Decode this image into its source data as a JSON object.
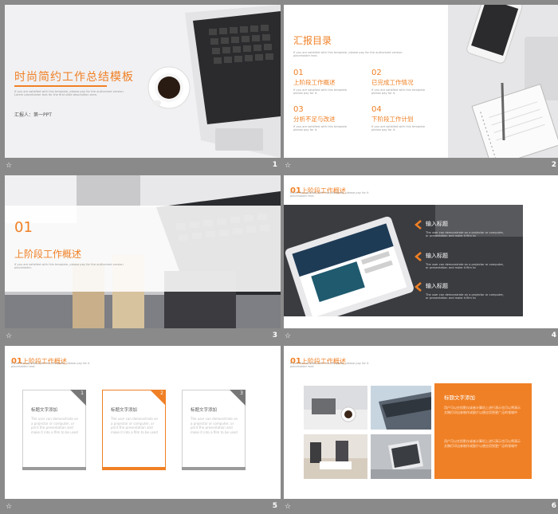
{
  "slides": [
    {
      "number": "1",
      "title": "时尚简约工作总结模板",
      "desc": "If you are satisfied with this template, please pay for the authorized version. Lorem placeholder text for the first slide description area.",
      "reporter": "汇报人：第一PPT"
    },
    {
      "number": "2",
      "title": "汇报目录",
      "desc": "If you are satisfied with this template, please pay for the authorized version placeholder text.",
      "items": [
        {
          "num": "01",
          "label": "上阶段工作概述",
          "desc": "If you are satisfied with this template please pay for it."
        },
        {
          "num": "02",
          "label": "已完成工作情况",
          "desc": "If you are satisfied with this template please pay for it."
        },
        {
          "num": "03",
          "label": "分析不足与改进",
          "desc": "If you are satisfied with this template please pay for it."
        },
        {
          "num": "04",
          "label": "下阶段工作计划",
          "desc": "If you are satisfied with this template please pay for it."
        }
      ]
    },
    {
      "number": "3",
      "num": "01",
      "title": "上阶段工作概述",
      "desc": "If you are satisfied with this template, please pay for the authorized version placeholder."
    },
    {
      "number": "4",
      "num": "01",
      "title": "上阶段工作概述",
      "desc": "If you are satisfied with this template, please pay for it placeholder text.",
      "items": [
        {
          "label": "输入标题",
          "desc": "The user can demonstrate on a projector or computer, or presentation and make it film to"
        },
        {
          "label": "输入标题",
          "desc": "The user can demonstrate on a projector or computer, or presentation and make it film to"
        },
        {
          "label": "输入标题",
          "desc": "The user can demonstrate on a projector or computer, or presentation and make it film to"
        }
      ]
    },
    {
      "number": "5",
      "num": "01",
      "title": "上阶段工作概述",
      "desc": "If you are satisfied with this template, please pay for it placeholder text.",
      "cards": [
        {
          "n": "1",
          "title": "标题文字添加",
          "desc": "The user can demonstrate on a projector or computer, or print the presentation and make it into a film to be used"
        },
        {
          "n": "2",
          "title": "标题文字添加",
          "desc": "The user can demonstrate on a projector or computer, or print the presentation and make it into a film to be used"
        },
        {
          "n": "3",
          "title": "标题文字添加",
          "desc": "The user can demonstrate on a projector or computer, or print the presentation and make it into a film to be used"
        }
      ]
    },
    {
      "number": "6",
      "num": "01",
      "title": "上阶段工作概述",
      "desc": "If you are satisfied with this template, please pay for it placeholder text.",
      "panel_title": "标题文字添加",
      "panel_desc1": "用户可以在投影仪或者计算机上进行演示也可以将演示文稿打印出来制作成胶片以便应用到更广泛的领域中",
      "panel_desc2": "用户可以在投影仪或者计算机上进行演示也可以将演示文稿打印出来制作成胶片以便应用到更广泛的领域中"
    }
  ],
  "colors": {
    "accent": "#f08025",
    "frame": "#8a8a8a"
  },
  "icons": {
    "slide_star": "☆"
  }
}
